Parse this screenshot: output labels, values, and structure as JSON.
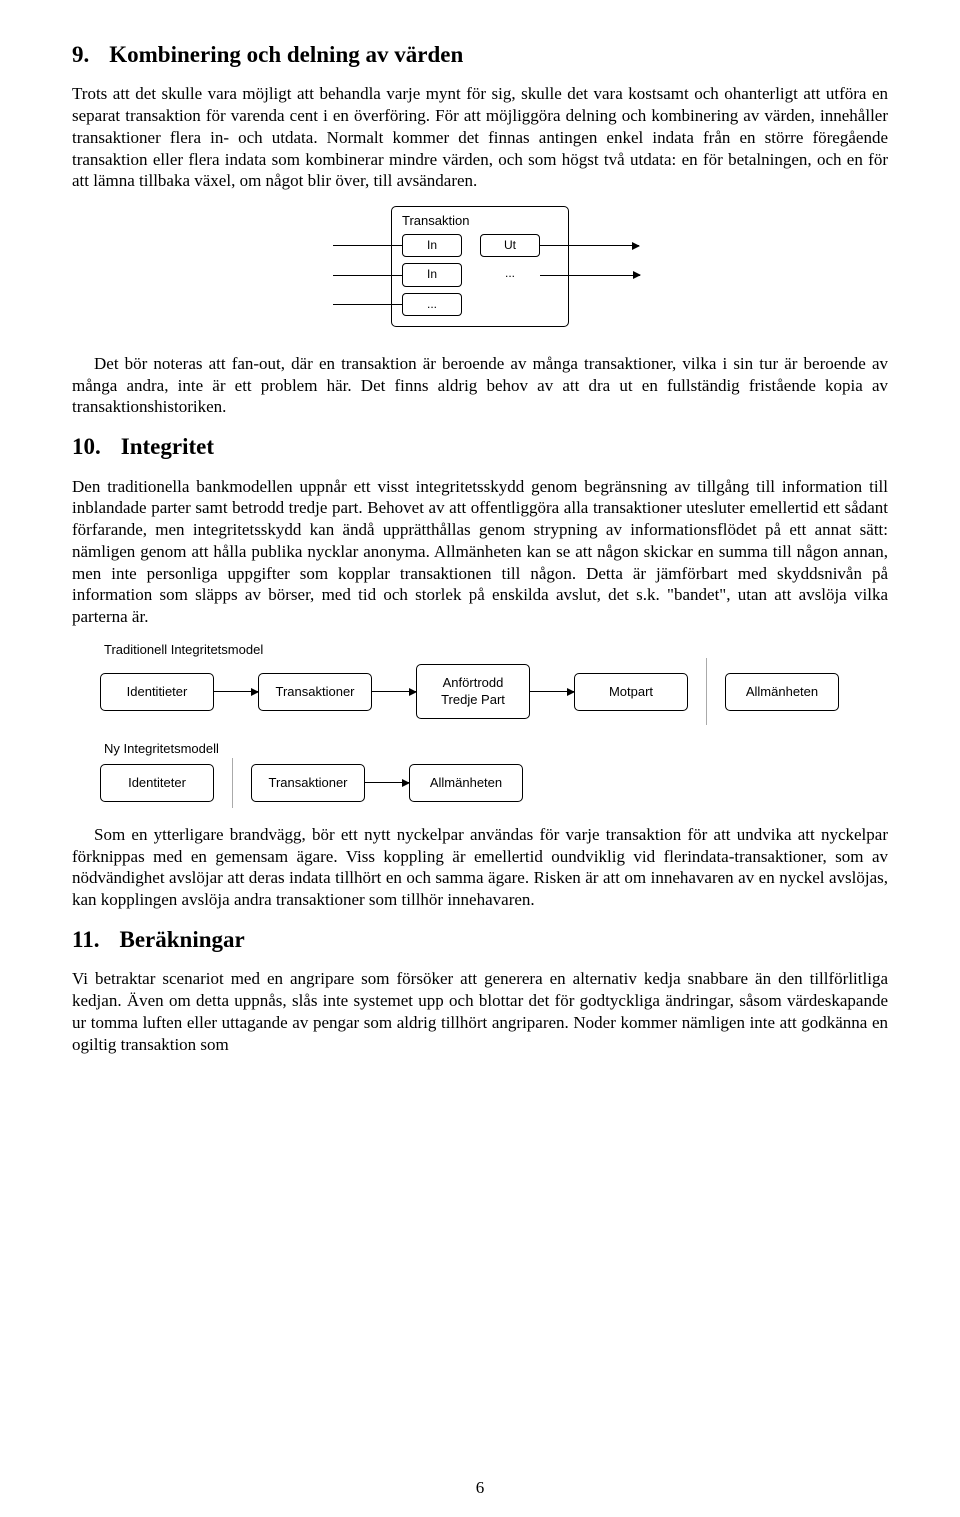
{
  "page_number": "6",
  "s9": {
    "num": "9.",
    "title": "Kombinering och delning av värden",
    "p1": "Trots att det skulle vara möjligt att behandla varje mynt för sig, skulle det vara kostsamt och ohanterligt att utföra en separat transaktion för varenda cent i en överföring. För att möjliggöra delning och kombinering av värden, innehåller transaktioner flera in- och utdata. Normalt kommer det finnas antingen enkel indata från en större föregående transaktion eller flera indata som kombinerar mindre värden, och som högst två utdata: en för betalningen, och en för att lämna tillbaka växel, om något blir över, till avsändaren.",
    "diagram": {
      "title": "Transaktion",
      "in": "In",
      "out": "Ut",
      "dots": "..."
    },
    "p2": "Det bör noteras att fan-out, där en transaktion är beroende av många transaktioner, vilka i sin tur är beroende av många andra, inte är ett problem här. Det finns aldrig behov av att dra ut en fullständig   fristående kopia av transaktionshistoriken."
  },
  "s10": {
    "num": "10.",
    "title": "Integritet",
    "p1": "Den traditionella bankmodellen uppnår ett visst integritetsskydd genom begränsning av tillgång till information till inblandade parter samt betrodd tredje part. Behovet av att offentliggöra alla transaktioner utesluter emellertid ett sådant förfarande, men integritetsskydd kan ändå upprätthållas genom strypning av informationsflödet på ett annat sätt: nämligen genom att hålla publika nycklar anonyma. Allmänheten kan se att någon skickar en summa till någon annan, men inte personliga uppgifter som kopplar transaktionen till någon. Detta är jämförbart med skyddsnivån på information som släpps av börser, med tid och storlek på enskilda avslut, det s.k. \"bandet\", utan att avslöja vilka parterna är.",
    "trad": {
      "title": "Traditionell Integritetsmodel",
      "identities": "Identitieter",
      "transactions": "Transaktioner",
      "trusted": "Anförtrodd\nTredje Part",
      "counterparty": "Motpart",
      "public": "Allmänheten"
    },
    "new": {
      "title": "Ny Integritetsmodell",
      "identities": "Identiteter",
      "transactions": "Transaktioner",
      "public": "Allmänheten"
    },
    "p2": "Som en ytterligare brandvägg, bör ett nytt nyckelpar användas för varje transaktion för att undvika att nyckelpar förknippas med en gemensam ägare. Viss koppling är emellertid oundviklig vid flerindata-transaktioner, som av nödvändighet avslöjar att deras indata tillhört en och samma ägare. Risken är att om innehavaren av en nyckel avslöjas, kan kopplingen avslöja andra transaktioner som tillhör innehavaren."
  },
  "s11": {
    "num": "11.",
    "title": "Beräkningar",
    "p1": "Vi betraktar scenariot med en angripare som försöker att generera en alternativ kedja snabbare än den tillförlitliga kedjan. Även om detta uppnås, slås inte systemet upp och blottar det för godtyckliga ändringar, såsom värdeskapande ur tomma luften eller uttagande av pengar som aldrig tillhört angriparen. Noder kommer nämligen inte att godkänna en ogiltig transaktion som"
  }
}
